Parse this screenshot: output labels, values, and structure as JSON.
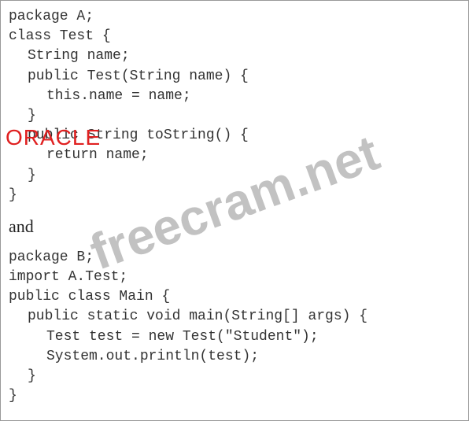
{
  "code_block_a": {
    "line1": "package A;",
    "line2": "class Test {",
    "line3": "String name;",
    "line4": "public Test(String name) {",
    "line5": "this.name = name;",
    "line6": "}",
    "line7": "public String toString() {",
    "line8": "return name;",
    "line9": "}",
    "line10": "}"
  },
  "separator": "and",
  "code_block_b": {
    "line1": "package B;",
    "line2": "import A.Test;",
    "line3": "public class Main {",
    "line4": "public static void main(String[] args) {",
    "line5": "Test test = new Test(\"Student\");",
    "line6": "System.out.println(test);",
    "line7": "}",
    "line8": "}"
  },
  "oracle_label": "ORACLE",
  "watermark_text": "freecram.net"
}
